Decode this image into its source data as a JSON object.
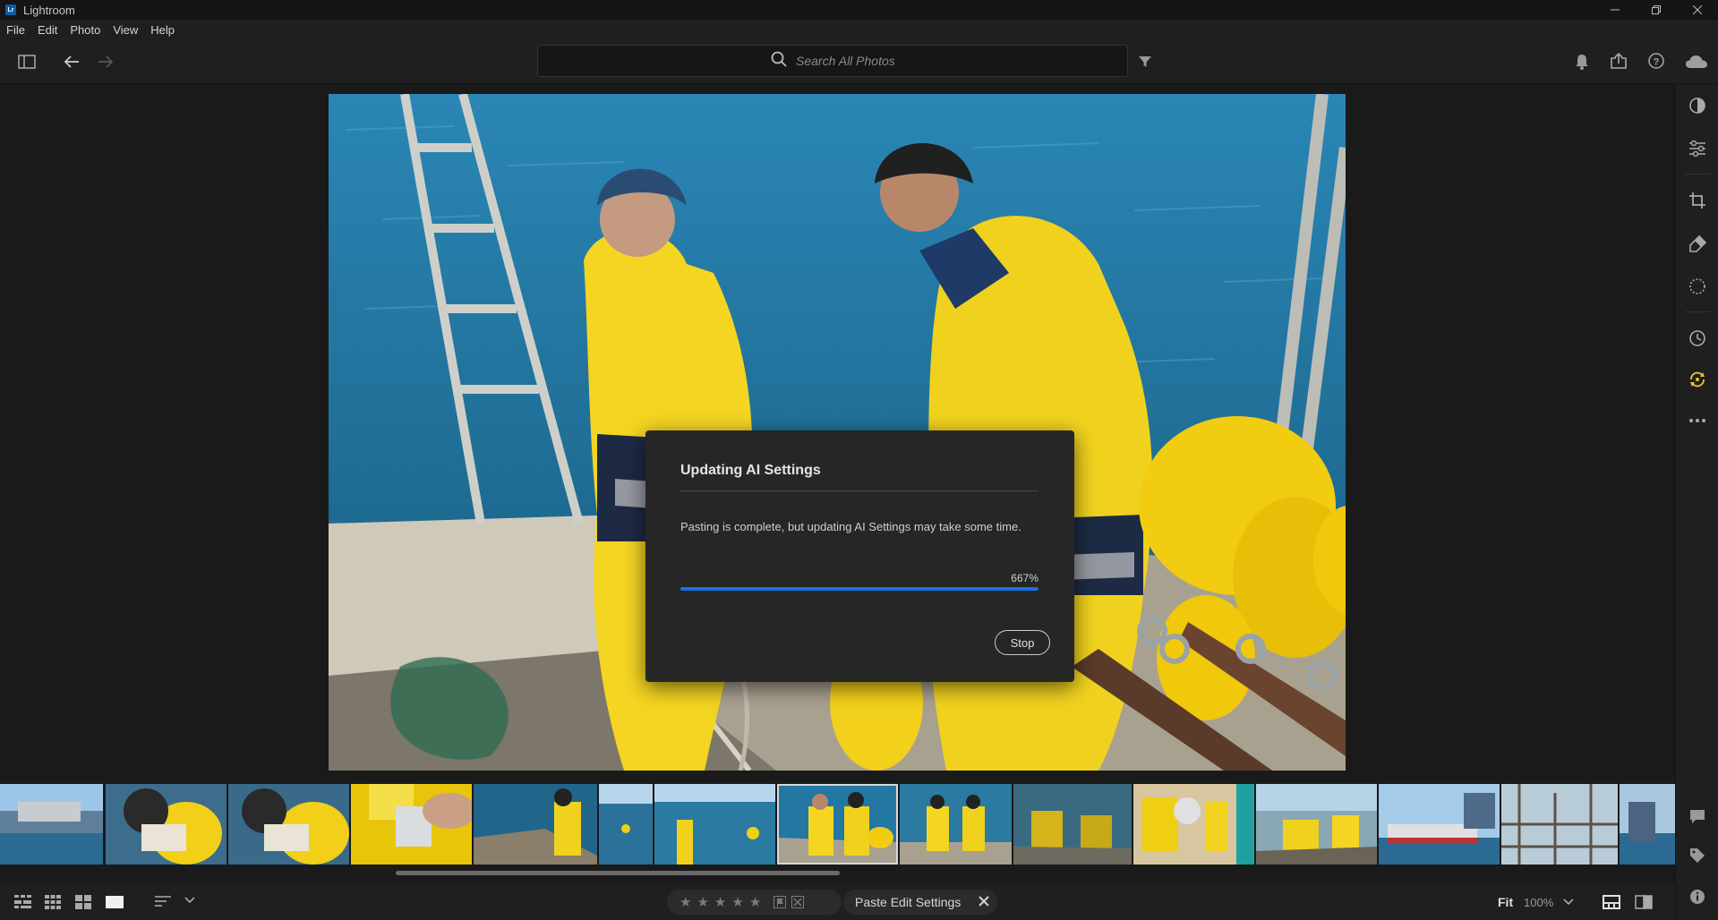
{
  "window": {
    "logo": "Lr",
    "title": "Lightroom",
    "controls": [
      "minimize",
      "restore",
      "close"
    ]
  },
  "menu": [
    "File",
    "Edit",
    "Photo",
    "View",
    "Help"
  ],
  "toolbar": {
    "search_placeholder": "Search All Photos",
    "left_icons": [
      "panel-toggle-icon",
      "back-arrow-icon",
      "forward-arrow-icon"
    ],
    "right_icons": [
      "bell-icon",
      "share-icon",
      "help-icon",
      "cloud-icon"
    ]
  },
  "right_rail": {
    "icons": [
      "presets-icon",
      "edit-sliders-icon",
      "crop-icon",
      "healing-icon",
      "masking-icon",
      "versions-icon",
      "ai-sync-icon",
      "more-icon",
      "comment-icon",
      "keyword-tag-icon",
      "info-icon"
    ],
    "active_color": "#e8c23a"
  },
  "dialog": {
    "title": "Updating AI Settings",
    "message": "Pasting is complete, but updating AI Settings may take some time.",
    "progress_label": "667%",
    "progress_fraction": 1.0,
    "stop_label": "Stop",
    "accent_color": "#1473e6"
  },
  "filmstrip": {
    "thumb_count": 14,
    "selected_index": 7
  },
  "bottombar": {
    "view_icons": [
      "grid-small-icon",
      "grid-medium-icon",
      "grid-large-icon",
      "single-view-icon"
    ],
    "sort_icon": "sort-icon",
    "stars": [
      "★",
      "★",
      "★",
      "★",
      "★"
    ],
    "paste_label": "Paste Edit Settings",
    "zoom_fit": "Fit",
    "zoom_level": "100%",
    "right_icons": [
      "filmstrip-toggle-icon",
      "compare-icon"
    ]
  }
}
